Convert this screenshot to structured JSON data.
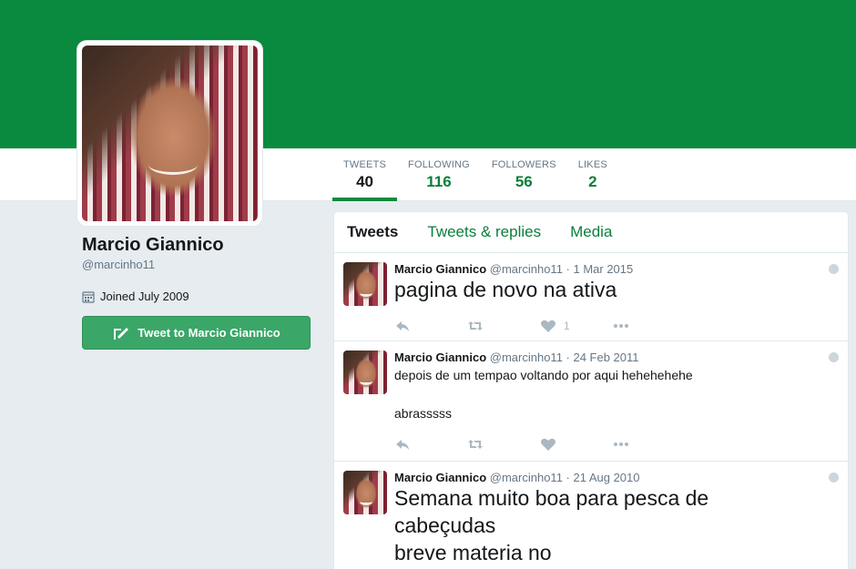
{
  "profile": {
    "name": "Marcio Giannico",
    "handle": "@marcinho11",
    "joined": "Joined July 2009",
    "tweet_to_label": "Tweet to Marcio Giannico"
  },
  "nav": {
    "stats": [
      {
        "label": "TWEETS",
        "value": "40"
      },
      {
        "label": "FOLLOWING",
        "value": "116"
      },
      {
        "label": "FOLLOWERS",
        "value": "56"
      },
      {
        "label": "LIKES",
        "value": "2"
      }
    ]
  },
  "timeline": {
    "tabs": [
      "Tweets",
      "Tweets & replies",
      "Media"
    ],
    "tweets": [
      {
        "name": "Marcio Giannico",
        "meta": "@marcinho11 · 1 Mar 2015",
        "text": "pagina de novo na ativa",
        "likes": "1"
      },
      {
        "name": "Marcio Giannico",
        "meta": "@marcinho11 · 24 Feb 2011",
        "text": "depois de um tempao voltando por aqui hehehehehe\n\nabrasssss",
        "likes": ""
      },
      {
        "name": "Marcio Giannico",
        "meta": "@marcinho11 · 21 Aug 2010",
        "text": "Semana muito boa para pesca de cabeçudas\nbreve materia no",
        "likes": ""
      }
    ]
  },
  "colors": {
    "brand": "#0a8a3e",
    "link": "#0a7f3a",
    "button": "#3aa668"
  }
}
